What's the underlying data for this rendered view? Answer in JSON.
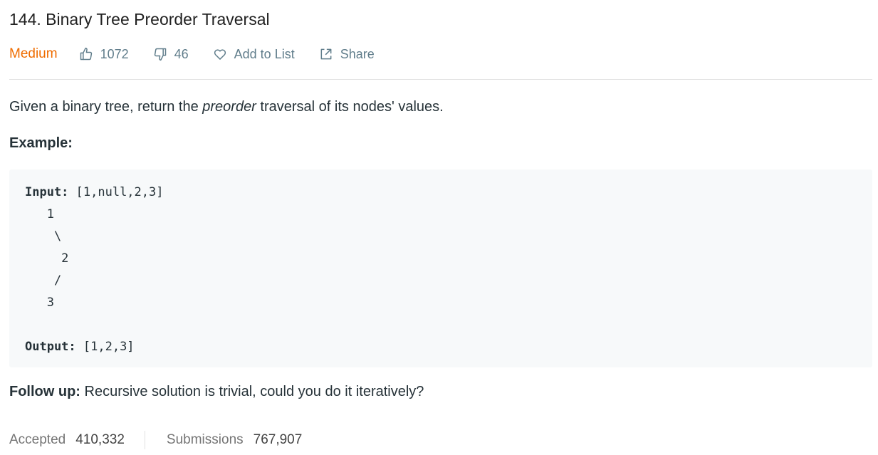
{
  "problem": {
    "title": "144. Binary Tree Preorder Traversal",
    "difficulty": "Medium",
    "likes": "1072",
    "dislikes": "46",
    "add_to_list_label": "Add to List",
    "share_label": "Share"
  },
  "description": {
    "before": "Given a binary tree, return the ",
    "emphasis": "preorder",
    "after": " traversal of its nodes' values."
  },
  "example": {
    "heading": "Example:",
    "input_label": "Input:",
    "input_value": " [1,null,2,3]",
    "tree_lines": [
      "   1",
      "    \\",
      "     2",
      "    /",
      "   3"
    ],
    "output_label": "Output:",
    "output_value": " [1,2,3]"
  },
  "followup": {
    "label": "Follow up:",
    "text": " Recursive solution is trivial, could you do it iteratively?"
  },
  "stats": {
    "accepted_label": "Accepted",
    "accepted_value": "410,332",
    "submissions_label": "Submissions",
    "submissions_value": "767,907"
  },
  "icons": {
    "like": "thumbs-up-icon",
    "dislike": "thumbs-down-icon",
    "add_to_list": "heart-icon",
    "share": "share-icon"
  },
  "colors": {
    "difficulty_medium": "#ef6c00",
    "meta_text": "#607d8b",
    "code_background": "#f7f9fa"
  }
}
